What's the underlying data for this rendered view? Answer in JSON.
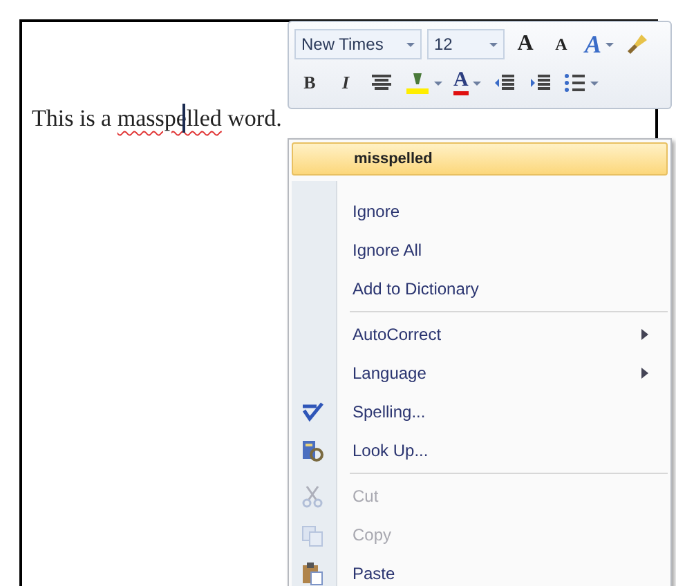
{
  "document": {
    "before": "This is a ",
    "misspelled": "masspelled",
    "after": " word."
  },
  "mini_toolbar": {
    "font": "New Times",
    "size": "12",
    "row_1": [
      {
        "kind": "grow",
        "glyph": "A"
      },
      {
        "kind": "shrink",
        "glyph": "A"
      },
      {
        "kind": "styles",
        "glyph": "A"
      },
      {
        "kind": "painter"
      }
    ],
    "row_2": [
      {
        "kind": "bold",
        "glyph": "B"
      },
      {
        "kind": "italic",
        "glyph": "I"
      },
      {
        "kind": "center"
      },
      {
        "kind": "highlight"
      },
      {
        "kind": "color",
        "glyph": "A"
      },
      {
        "kind": "outdent"
      },
      {
        "kind": "indent"
      },
      {
        "kind": "bullets"
      }
    ]
  },
  "context_menu": {
    "suggestion": "misspelled",
    "items": [
      {
        "label": "Ignore",
        "disabled": false,
        "submenu": false
      },
      {
        "label": "Ignore All",
        "disabled": false,
        "submenu": false
      },
      {
        "label": "Add to Dictionary",
        "disabled": false,
        "submenu": false,
        "separator_after": true
      },
      {
        "label": "AutoCorrect",
        "disabled": false,
        "submenu": true
      },
      {
        "label": "Language",
        "disabled": false,
        "submenu": true
      },
      {
        "label": "Spelling...",
        "disabled": false,
        "submenu": false
      },
      {
        "label": "Look Up...",
        "disabled": false,
        "submenu": false,
        "separator_after": true
      },
      {
        "label": "Cut",
        "disabled": true,
        "submenu": false
      },
      {
        "label": "Copy",
        "disabled": true,
        "submenu": false
      },
      {
        "label": "Paste",
        "disabled": false,
        "submenu": false
      }
    ]
  }
}
